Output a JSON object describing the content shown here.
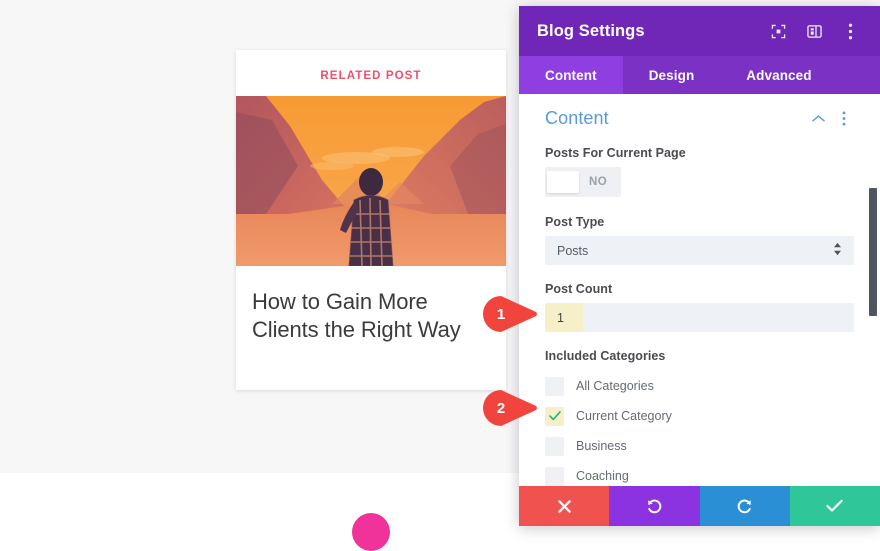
{
  "page": {
    "background_color": "#f7f7f8",
    "blob_color": "#f0339a"
  },
  "post_card": {
    "eyebrow": "RELATED POST",
    "eyebrow_color": "#ef4f6b",
    "title": "How to Gain More Clients the Right Way",
    "image_alt": "person-standing-by-lake-mountains-sunset-duotone",
    "image_tint": "#f79a3c"
  },
  "settings_panel": {
    "header": {
      "title": "Blog Settings",
      "background_color": "#7027b8",
      "icons": [
        {
          "name": "focus-expand-icon",
          "glyph": "expand"
        },
        {
          "name": "panel-layout-icon",
          "glyph": "layout"
        },
        {
          "name": "more-options-icon",
          "glyph": "dots"
        }
      ]
    },
    "tabs": [
      {
        "label": "Content",
        "active": true
      },
      {
        "label": "Design",
        "active": false
      },
      {
        "label": "Advanced",
        "active": false
      }
    ],
    "section": {
      "title": "Content",
      "title_color": "#5a9ada",
      "collapse_icon": "chevron-up-icon",
      "menu_icon": "section-more-icon"
    },
    "fields": {
      "posts_for_current_page": {
        "label": "Posts For Current Page",
        "toggle_state": "NO"
      },
      "post_type": {
        "label": "Post Type",
        "value": "Posts"
      },
      "post_count": {
        "label": "Post Count",
        "value": "1"
      },
      "included_categories": {
        "label": "Included Categories",
        "options": [
          {
            "label": "All Categories",
            "checked": false
          },
          {
            "label": "Current Category",
            "checked": true
          },
          {
            "label": "Business",
            "checked": false
          },
          {
            "label": "Coaching",
            "checked": false
          }
        ]
      }
    },
    "footer_buttons": [
      {
        "name": "cancel-button",
        "icon": "close-icon",
        "color": "#f0524f"
      },
      {
        "name": "undo-button",
        "icon": "undo-icon",
        "color": "#8b33e0"
      },
      {
        "name": "redo-button",
        "icon": "redo-icon",
        "color": "#2b8fd6"
      },
      {
        "name": "save-button",
        "icon": "checkmark-icon",
        "color": "#2fc69a"
      }
    ]
  },
  "annotations": [
    {
      "number": "1",
      "color": "#f0443c",
      "points_to": "post-count-field"
    },
    {
      "number": "2",
      "color": "#f0443c",
      "points_to": "current-category-checkbox"
    }
  ]
}
